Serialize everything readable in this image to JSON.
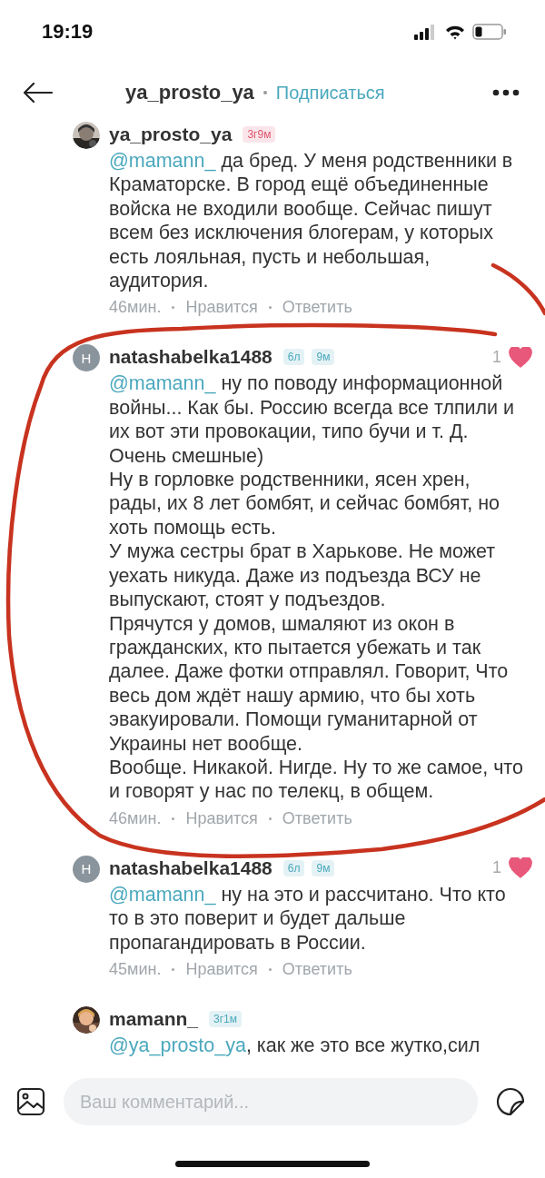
{
  "status_bar": {
    "time": "19:19"
  },
  "header": {
    "username": "ya_prosto_ya",
    "follow": "Подписаться"
  },
  "comments": [
    {
      "avatar": {
        "kind": "picture"
      },
      "username": "ya_prosto_ya",
      "badges": [
        {
          "text": "3г9м",
          "color": "#e0566f"
        }
      ],
      "mention": "@mamann_",
      "text": " да бред. У меня родственники в Краматорске. В город ещё объединенные войска не входили вообще. Сейчас пишут всем без исключения блогерам, у которых есть лояльная, пусть и небольшая, аудитория.",
      "meta": {
        "time": "46мин.",
        "like": "Нравится",
        "reply": "Ответить"
      }
    },
    {
      "avatar": {
        "kind": "letter",
        "letter": "Н"
      },
      "username": "natashabelka1488",
      "badges": [
        {
          "text": "6л",
          "color": "#4aa8bd"
        },
        {
          "text": "9м",
          "color": "#4aa8bd"
        }
      ],
      "likes": {
        "count": "1",
        "liked": true
      },
      "mention": "@mamann_",
      "text": " ну по поводу информационной войны... Как бы. Россию всегда все тлпили и их вот эти провокации, типо бучи и т. Д. Очень смешные)\nНу в горловке родственники, ясен хрен, рады, их 8 лет бомбят, и сейчас бомбят, но хоть помощь есть.\nУ мужа сестры брат в Харькове. Не может уехать никуда. Даже из подъезда ВСУ не выпускают, стоят у подъездов.\nПрячутся у домов, шмаляют из окон в гражданских, кто пытается убежать и так далее. Даже фотки отправлял. Говорит, Что весь дом ждёт нашу армию, что бы хоть эвакуировали. Помощи гуманитарной от Украины нет вообще.\nВообще. Никакой. Нигде. Ну то же самое, что и говорят у нас по телекц, в общем.",
      "meta": {
        "time": "46мин.",
        "like": "Нравится",
        "reply": "Ответить"
      }
    },
    {
      "avatar": {
        "kind": "letter",
        "letter": "Н"
      },
      "username": "natashabelka1488",
      "badges": [
        {
          "text": "6л",
          "color": "#4aa8bd"
        },
        {
          "text": "9м",
          "color": "#4aa8bd"
        }
      ],
      "likes": {
        "count": "1",
        "liked": true
      },
      "mention": "@mamann_",
      "text": " ну на это и рассчитано. Что кто то в это поверит и будет дальше пропагандировать в России.",
      "meta": {
        "time": "45мин.",
        "like": "Нравится",
        "reply": "Ответить"
      }
    },
    {
      "avatar": {
        "kind": "picture"
      },
      "username": "mamann_",
      "badges": [
        {
          "text": "3г1м",
          "color": "#4aa8bd"
        }
      ],
      "mention": "@ya_prosto_ya",
      "text": ", как же это все жутко,сил"
    }
  ],
  "composer": {
    "placeholder": "Ваш комментарий..."
  }
}
